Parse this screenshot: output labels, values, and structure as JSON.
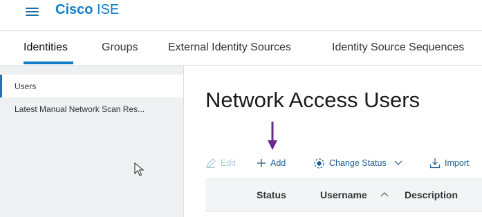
{
  "header": {
    "brand": "Cisco",
    "product": "ISE",
    "menu_icon": "hamburger-menu-icon"
  },
  "tabs": [
    {
      "label": "Identities",
      "active": true
    },
    {
      "label": "Groups",
      "active": false
    },
    {
      "label": "External Identity Sources",
      "active": false
    },
    {
      "label": "Identity Source Sequences",
      "active": false
    }
  ],
  "sidebar": {
    "items": [
      {
        "label": "Users",
        "active": true
      },
      {
        "label": "Latest Manual Network Scan Res...",
        "active": false
      }
    ]
  },
  "main": {
    "title": "Network Access Users",
    "toolbar": {
      "edit": {
        "label": "Edit",
        "icon": "pencil-icon",
        "enabled": false
      },
      "add": {
        "label": "Add",
        "icon": "plus-icon",
        "enabled": true
      },
      "change_status": {
        "label": "Change Status",
        "icon": "status-toggle-icon",
        "enabled": true
      },
      "import": {
        "label": "Import",
        "icon": "import-icon",
        "enabled": true
      }
    },
    "table": {
      "columns": [
        "Status",
        "Username",
        "Description"
      ],
      "sorted_column": "Username",
      "sort_direction": "ascending"
    }
  },
  "colors": {
    "brand": "#0e7fc6",
    "accent": "#1f5f95",
    "disabled": "#a9c8e2",
    "annotation_arrow": "#6a2a8c"
  }
}
